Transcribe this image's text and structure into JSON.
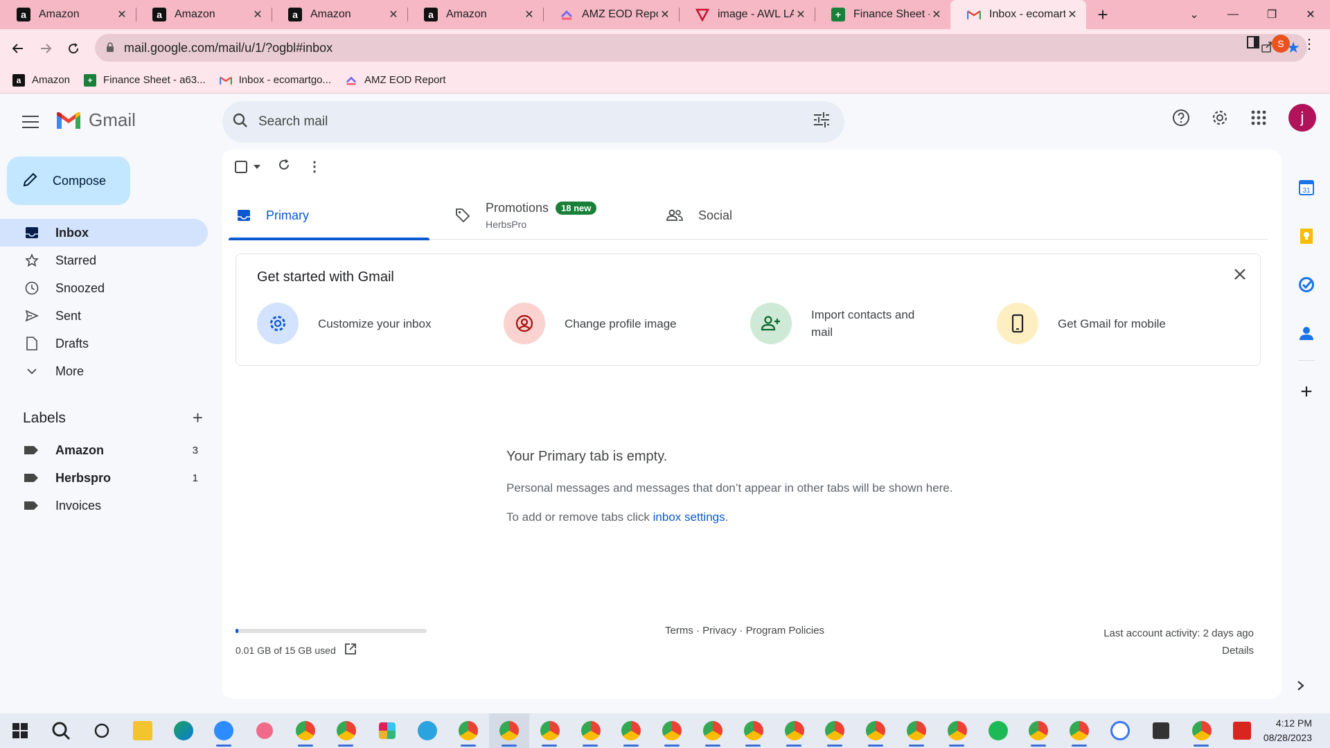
{
  "browser": {
    "tabs": [
      {
        "title": "Amazon",
        "icon": "amazon-icon",
        "active": false
      },
      {
        "title": "Amazon",
        "icon": "amazon-icon",
        "active": false
      },
      {
        "title": "Amazon",
        "icon": "amazon-icon",
        "active": false
      },
      {
        "title": "Amazon",
        "icon": "amazon-icon",
        "active": false
      },
      {
        "title": "AMZ EOD Report",
        "icon": "clickup-icon",
        "active": false
      },
      {
        "title": "image - AWL LAB",
        "icon": "awl-icon",
        "active": false
      },
      {
        "title": "Finance Sheet - a",
        "icon": "sheets-icon",
        "active": false
      },
      {
        "title": "Inbox - ecomartg",
        "icon": "gmail-icon",
        "active": true
      }
    ],
    "url": "mail.google.com/mail/u/1/?ogbl#inbox",
    "profile_initial": "S",
    "bookmarks": [
      {
        "label": "Amazon",
        "icon": "amazon-icon"
      },
      {
        "label": "Finance Sheet - a63...",
        "icon": "sheets-icon"
      },
      {
        "label": "Inbox - ecomartgo...",
        "icon": "gmail-icon"
      },
      {
        "label": "AMZ EOD Report",
        "icon": "clickup-icon"
      }
    ]
  },
  "gmail": {
    "brand": "Gmail",
    "search_placeholder": "Search mail",
    "avatar_initial": "j",
    "compose_label": "Compose",
    "nav": [
      {
        "label": "Inbox",
        "icon": "inbox-icon",
        "active": true
      },
      {
        "label": "Starred",
        "icon": "star-icon"
      },
      {
        "label": "Snoozed",
        "icon": "clock-icon"
      },
      {
        "label": "Sent",
        "icon": "send-icon"
      },
      {
        "label": "Drafts",
        "icon": "draft-icon"
      },
      {
        "label": "More",
        "icon": "chevron-down-icon"
      }
    ],
    "labels_heading": "Labels",
    "labels": [
      {
        "name": "Amazon",
        "count": "3",
        "bold": true
      },
      {
        "name": "Herbspro",
        "count": "1",
        "bold": true
      },
      {
        "name": "Invoices",
        "count": "",
        "bold": false
      }
    ],
    "inbox_tabs": {
      "primary": "Primary",
      "promotions": "Promotions",
      "promotions_badge": "18 new",
      "promotions_sub": "HerbsPro",
      "social": "Social"
    },
    "get_started": {
      "title": "Get started with Gmail",
      "items": [
        {
          "text": "Customize your inbox",
          "icon": "gear-icon",
          "color": "#d3e3fd"
        },
        {
          "text": "Change profile image",
          "icon": "profile-icon",
          "color": "#fad2cf"
        },
        {
          "text": "Import contacts and mail",
          "icon": "add-person-icon",
          "color": "#ceead6"
        },
        {
          "text": "Get Gmail for mobile",
          "icon": "phone-icon",
          "color": "#feefc3"
        }
      ]
    },
    "empty": {
      "title": "Your Primary tab is empty.",
      "line1": "Personal messages and messages that don’t appear in other tabs will be shown here.",
      "line2_prefix": "To add or remove tabs click ",
      "line2_link": "inbox settings",
      "line2_suffix": "."
    },
    "footer": {
      "storage_text": "0.01 GB of 15 GB used",
      "storage_used_fraction": 0.0007,
      "links": "Terms · Privacy · Program Policies",
      "activity": "Last account activity: 2 days ago",
      "details": "Details"
    }
  },
  "taskbar": {
    "time": "4:12 PM",
    "date": "08/28/2023"
  },
  "colors": {
    "accent": "#0b57d0",
    "tabbar": "#f5b8c4",
    "toolbar": "#fde7ec",
    "compose": "#c2e7ff",
    "nav_active": "#d3e3fd",
    "badge": "#188038",
    "avatar": "#b0135a"
  }
}
